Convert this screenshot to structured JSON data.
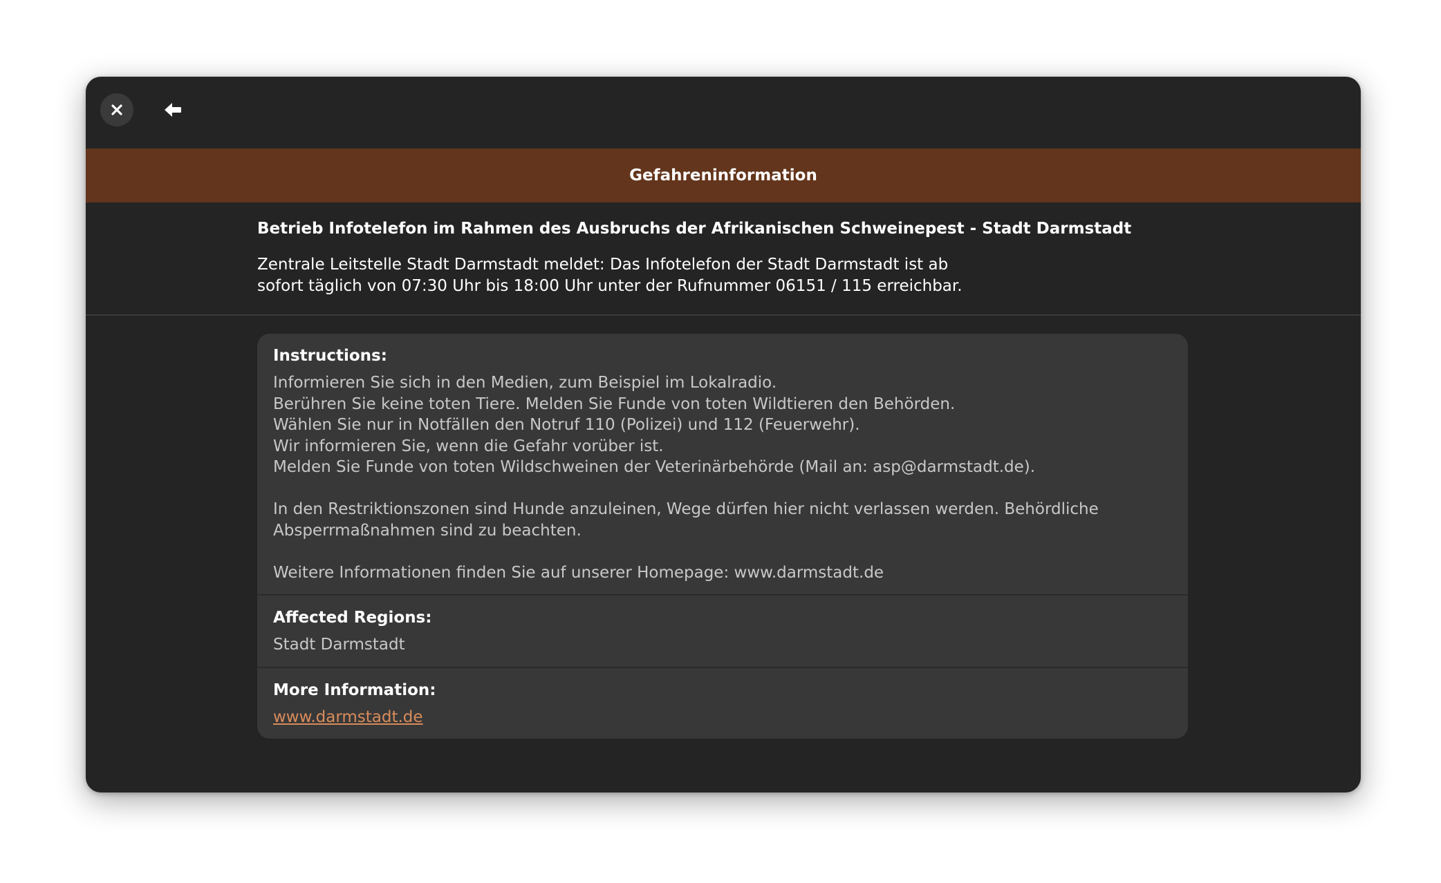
{
  "window": {
    "close_icon": "close-icon",
    "back_icon": "arrow-left-icon"
  },
  "banner": {
    "title": "Gefahreninformation",
    "color": "#63351c"
  },
  "summary": {
    "headline": "Betrieb Infotelefon im Rahmen des Ausbruchs der Afrikanischen Schweinepest - Stadt Darmstadt",
    "description": "Zentrale Leitstelle Stadt Darmstadt meldet: Das Infotelefon der Stadt Darmstadt ist ab\nsofort täglich von 07:30 Uhr bis 18:00 Uhr unter der Rufnummer 06151 / 115 erreichbar."
  },
  "details": {
    "instructions": {
      "label": "Instructions:",
      "text": "Informieren Sie sich in den Medien, zum Beispiel im Lokalradio.\nBerühren Sie keine toten Tiere. Melden Sie Funde von toten Wildtieren den Behörden.\nWählen Sie nur in Notfällen den Notruf 110 (Polizei) und 112 (Feuerwehr).\nWir informieren Sie, wenn die Gefahr vorüber ist.\nMelden Sie Funde von toten Wildschweinen der Veterinärbehörde (Mail an: asp@darmstadt.de).\n\nIn den Restriktionszonen sind Hunde anzuleinen, Wege dürfen hier nicht verlassen werden. Behördliche\nAbsperrmaßnahmen sind zu beachten.\n\nWeitere Informationen finden Sie auf unserer Homepage: www.darmstadt.de"
    },
    "regions": {
      "label": "Affected Regions:",
      "text": "Stadt Darmstadt"
    },
    "more_info": {
      "label": "More Information:",
      "link": "www.darmstadt.de",
      "link_color": "#d98c5b"
    }
  }
}
